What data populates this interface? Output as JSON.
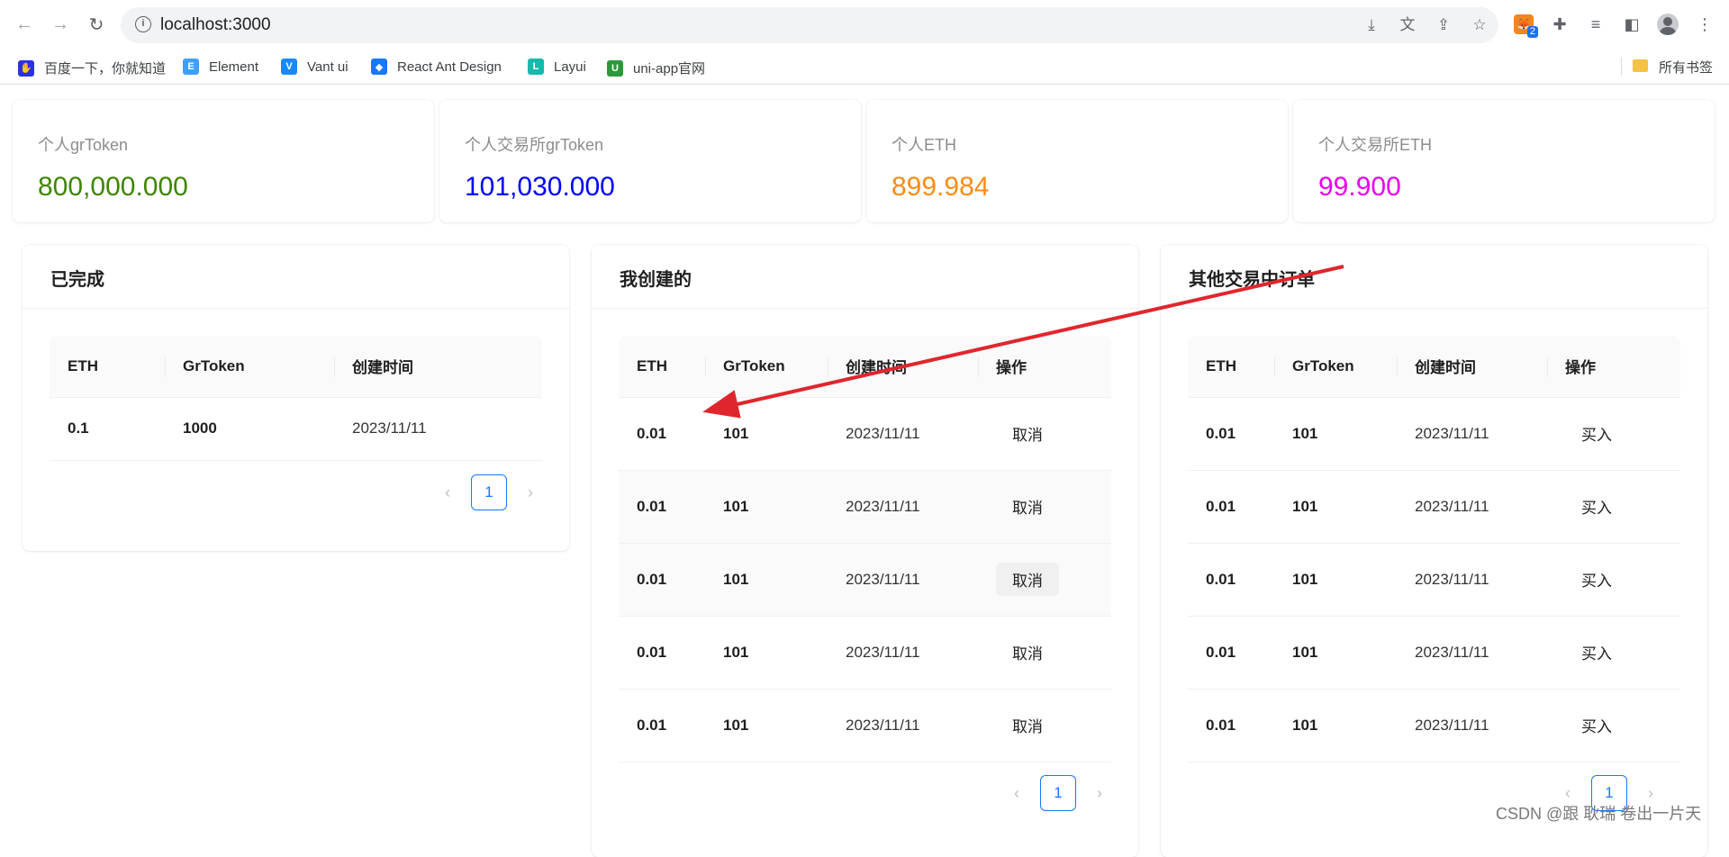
{
  "browser": {
    "url": "localhost:3000",
    "extension_badge": "2",
    "bookmarks": [
      {
        "label": "百度一下，你就知道",
        "icon": "baidu-icon",
        "color": "#2932e1"
      },
      {
        "label": "Element",
        "icon": "element-icon",
        "color": "#409eff"
      },
      {
        "label": "Vant ui",
        "icon": "vant-icon",
        "color": "#1989fa"
      },
      {
        "label": "React Ant Design",
        "icon": "ant-design-icon",
        "color": "#1677ff"
      },
      {
        "label": "Layui",
        "icon": "layui-icon",
        "color": "#16baaa"
      },
      {
        "label": "uni-app官网",
        "icon": "uniapp-icon",
        "color": "#2b9939"
      }
    ],
    "all_bookmarks": "所有书签"
  },
  "stats": [
    {
      "label": "个人grToken",
      "value": "800,000.000",
      "color": "#3f8600"
    },
    {
      "label": "个人交易所grToken",
      "value": "101,030.000",
      "color": "#0000ff"
    },
    {
      "label": "个人ETH",
      "value": "899.984",
      "color": "#fa8c16"
    },
    {
      "label": "个人交易所ETH",
      "value": "99.900",
      "color": "#eb00eb"
    }
  ],
  "completed": {
    "title": "已完成",
    "columns": [
      "ETH",
      "GrToken",
      "创建时间"
    ],
    "rows": [
      {
        "eth": "0.1",
        "gr": "1000",
        "time": "2023/11/11"
      }
    ],
    "page": "1"
  },
  "mine": {
    "title": "我创建的",
    "columns": [
      "ETH",
      "GrToken",
      "创建时间",
      "操作"
    ],
    "action": "取消",
    "rows": [
      {
        "eth": "0.01",
        "gr": "101",
        "time": "2023/11/11"
      },
      {
        "eth": "0.01",
        "gr": "101",
        "time": "2023/11/11"
      },
      {
        "eth": "0.01",
        "gr": "101",
        "time": "2023/11/11"
      },
      {
        "eth": "0.01",
        "gr": "101",
        "time": "2023/11/11"
      },
      {
        "eth": "0.01",
        "gr": "101",
        "time": "2023/11/11"
      }
    ],
    "page": "1"
  },
  "others": {
    "title": "其他交易中订单",
    "columns": [
      "ETH",
      "GrToken",
      "创建时间",
      "操作"
    ],
    "action": "买入",
    "rows": [
      {
        "eth": "0.01",
        "gr": "101",
        "time": "2023/11/11"
      },
      {
        "eth": "0.01",
        "gr": "101",
        "time": "2023/11/11"
      },
      {
        "eth": "0.01",
        "gr": "101",
        "time": "2023/11/11"
      },
      {
        "eth": "0.01",
        "gr": "101",
        "time": "2023/11/11"
      },
      {
        "eth": "0.01",
        "gr": "101",
        "time": "2023/11/11"
      }
    ],
    "page": "1"
  },
  "watermark": "CSDN @跟 耿瑞 卷出一片天",
  "annotation_color": "#e0262d"
}
